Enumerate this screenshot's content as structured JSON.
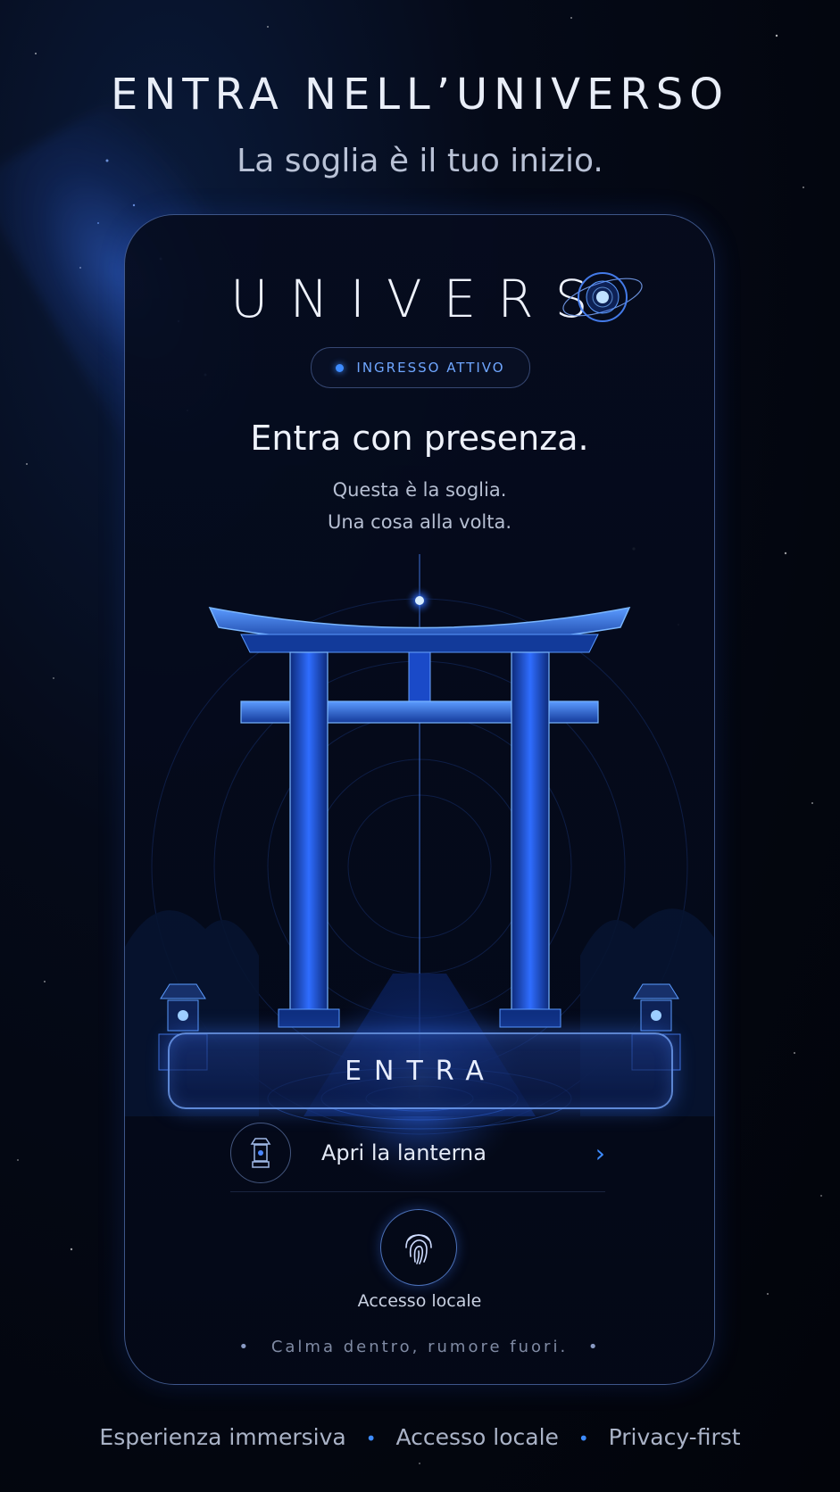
{
  "hero": {
    "title": "ENTRA NELL’UNIVERSO",
    "subtitle": "La soglia è il tuo inizio."
  },
  "card": {
    "logo": "UNIVERS",
    "badge": "INGRESSO ATTIVO",
    "headline": "Entra con presenza.",
    "line1": "Questa è la soglia.",
    "line2": "Una cosa alla volta.",
    "enter_button": "ENTRA",
    "lantern_label": "Apri la lanterna",
    "local_access_label": "Accesso locale",
    "motto": "Calma dentro, rumore fuori."
  },
  "footer": {
    "items": [
      "Esperienza immersiva",
      "Accesso locale",
      "Privacy-first"
    ]
  },
  "colors": {
    "accent": "#3d8bff",
    "background": "#03060f",
    "text": "#e9eef8"
  },
  "icons": [
    "planet-orb-icon",
    "lantern-icon",
    "chevron-right-icon",
    "fingerprint-icon",
    "torii-gate-illustration"
  ]
}
